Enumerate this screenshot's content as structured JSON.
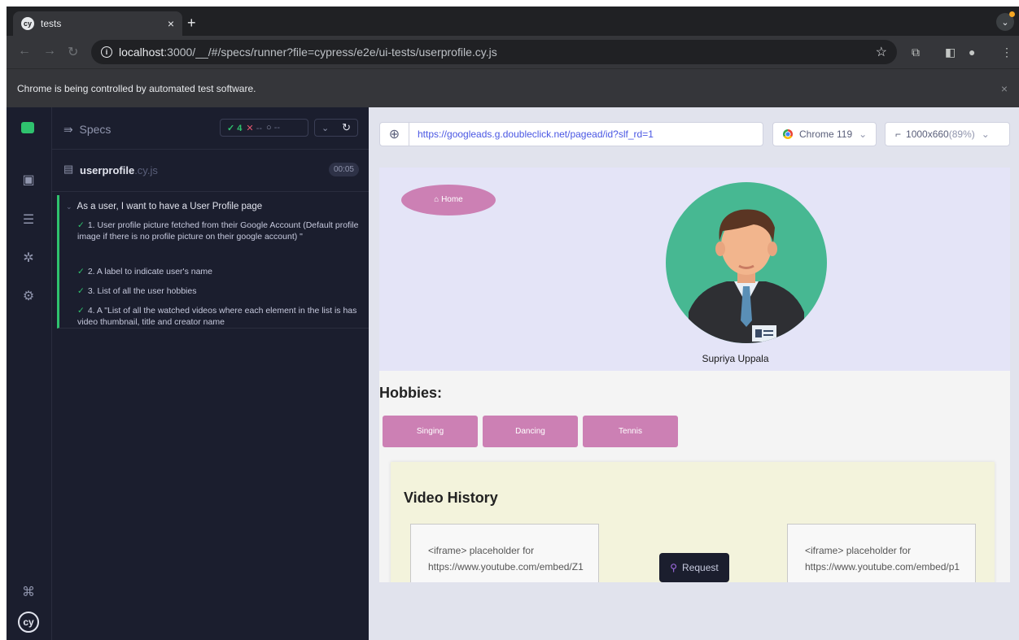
{
  "browser": {
    "tab_title": "tests",
    "tab_close": "×",
    "new_tab": "+",
    "url_host": "localhost",
    "url_rest": ":3000/__/#/specs/runner?file=cypress/e2e/ui-tests/userprofile.cy.js",
    "infobar_text": "Chrome is being controlled by automated test software.",
    "infobar_close": "×"
  },
  "reporter": {
    "specs_label": "Specs",
    "passed": "4",
    "failed": "--",
    "pending": "--",
    "file_name": "userprofile",
    "file_ext": ".cy.js",
    "duration": "00:05",
    "suite_title": "As a user, I want to have a User Profile page",
    "tests": [
      "1. User profile picture fetched from their Google Account (Default profile image if there is no profile picture on their google account) \"",
      "2. A label to indicate user's name",
      "3. List of all the user hobbies",
      "4. A \"List of all the watched videos where each element in the list is has video thumbnail, title and creator name"
    ]
  },
  "preview": {
    "url": "https://googleads.g.doubleclick.net/pagead/id?slf_rd=1",
    "browser_name": "Chrome 119",
    "viewport": "1000x660",
    "viewport_pct": "(89%)",
    "request_label": "Request"
  },
  "app": {
    "home_label": "Home",
    "user_name": "Supriya Uppala",
    "hobbies_title": "Hobbies:",
    "hobbies": [
      "Singing",
      "Dancing",
      "Tennis"
    ],
    "video_history_title": "Video History",
    "iframes": [
      {
        "line1": "<iframe> placeholder for",
        "line2": "https://www.youtube.com/embed/Z1"
      },
      {
        "line1": "<iframe> placeholder for",
        "line2": "https://www.youtube.com/embed/p1"
      }
    ]
  },
  "colors": {
    "cypress_green": "#2fc26e",
    "hobby_pink": "#cc80b4",
    "avatar_green": "#47b892"
  }
}
